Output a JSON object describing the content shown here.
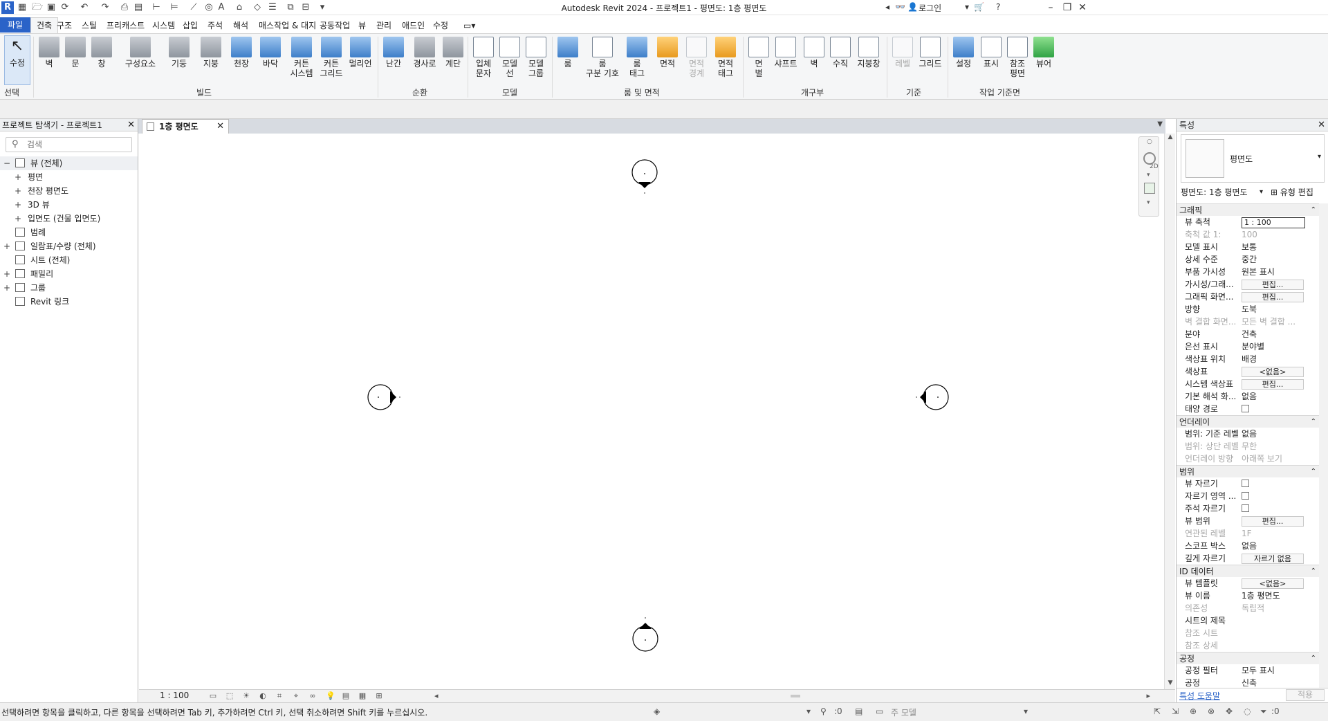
{
  "window": {
    "title": "Autodesk Revit 2024 - 프로젝트1 - 평면도: 1층 평면도",
    "logo_letter": "R",
    "login_label": "로그인",
    "help_label": "?"
  },
  "ribbon_tabs": [
    "파일",
    "건축",
    "구조",
    "스틸",
    "프리캐스트",
    "시스템",
    "삽입",
    "주석",
    "해석",
    "매스작업 & 대지",
    "공동작업",
    "뷰",
    "관리",
    "애드인",
    "수정"
  ],
  "ribbon": {
    "select_label": "선택",
    "panels": {
      "build": "빌드",
      "circulation": "순환",
      "model": "모델",
      "room_area": "룸 및 면적",
      "opening": "개구부",
      "datum": "기준",
      "work_plane": "작업 기준면"
    },
    "tools": {
      "modify": "수정",
      "wall": "벽",
      "door": "문",
      "window": "창",
      "component": "구성요소",
      "column": "기둥",
      "roof": "지붕",
      "ceiling": "천장",
      "floor": "바닥",
      "curtain_system": "커튼\n시스템",
      "curtain_grid": "커튼\n그리드",
      "mullion": "멀리언",
      "railing": "난간",
      "ramp": "경사로",
      "stair": "계단",
      "model_text": "입체\n문자",
      "model_line": "모델\n선",
      "model_group": "모델\n그룹",
      "room": "룸",
      "room_separator": "룸\n구분 기호",
      "room_tag": "룸\n태그",
      "area": "면적",
      "area_boundary": "면적\n경계",
      "area_tag": "면적\n태그",
      "by_face": "면\n별",
      "shaft": "샤프트",
      "wall_opening": "벽",
      "vertical": "수직",
      "dormer": "지붕창",
      "level": "레벨",
      "grid": "그리드",
      "set": "설정",
      "show": "표시",
      "ref_plane": "참조\n평면",
      "viewer": "뷰어"
    }
  },
  "project_browser": {
    "title": "프로젝트 탐색기 - 프로젝트1",
    "search_placeholder": "검색",
    "items": [
      {
        "toggle": "−",
        "label": "뷰 (전체)",
        "indent": 0,
        "selected": true,
        "icon": true
      },
      {
        "toggle": "+",
        "label": "평면",
        "indent": 1,
        "selected": false,
        "icon": false
      },
      {
        "toggle": "+",
        "label": "천장 평면도",
        "indent": 1,
        "selected": false,
        "icon": false
      },
      {
        "toggle": "+",
        "label": "3D 뷰",
        "indent": 1,
        "selected": false,
        "icon": false
      },
      {
        "toggle": "+",
        "label": "입면도 (건물 입면도)",
        "indent": 1,
        "selected": false,
        "icon": false
      },
      {
        "toggle": "",
        "label": "범례",
        "indent": 0,
        "selected": false,
        "icon": true
      },
      {
        "toggle": "+",
        "label": "일람표/수량 (전체)",
        "indent": 0,
        "selected": false,
        "icon": true
      },
      {
        "toggle": "",
        "label": "시트 (전체)",
        "indent": 0,
        "selected": false,
        "icon": true
      },
      {
        "toggle": "+",
        "label": "패밀리",
        "indent": 0,
        "selected": false,
        "icon": true
      },
      {
        "toggle": "+",
        "label": "그룹",
        "indent": 0,
        "selected": false,
        "icon": true
      },
      {
        "toggle": "",
        "label": "Revit 링크",
        "indent": 0,
        "selected": false,
        "icon": true
      }
    ]
  },
  "view_tab": {
    "label": "1층 평면도"
  },
  "view_control": {
    "scale": "1 : 100"
  },
  "properties": {
    "title": "특성",
    "type_name": "평면도",
    "selector": "평면도: 1층 평면도",
    "edit_type": "유형 편집",
    "groups": [
      {
        "name": "그래픽",
        "rows": [
          {
            "key": "뷰 축척",
            "val": "1 : 100",
            "kind": "input"
          },
          {
            "key": "축척 값    1:",
            "val": "100",
            "kind": "text",
            "dim": true
          },
          {
            "key": "모델 표시",
            "val": "보통",
            "kind": "text"
          },
          {
            "key": "상세 수준",
            "val": "중간",
            "kind": "text"
          },
          {
            "key": "부품 가시성",
            "val": "원본 표시",
            "kind": "text"
          },
          {
            "key": "가시성/그래...",
            "val": "편집...",
            "kind": "button"
          },
          {
            "key": "그래픽 화면...",
            "val": "편집...",
            "kind": "button"
          },
          {
            "key": "방향",
            "val": "도북",
            "kind": "text"
          },
          {
            "key": "벽 결합 화면...",
            "val": "모든 벽 결합 ...",
            "kind": "text",
            "dim": true
          },
          {
            "key": "분야",
            "val": "건축",
            "kind": "text"
          },
          {
            "key": "은선 표시",
            "val": "분야별",
            "kind": "text"
          },
          {
            "key": "색상표 위치",
            "val": "배경",
            "kind": "text"
          },
          {
            "key": "색상표",
            "val": "<없음>",
            "kind": "button"
          },
          {
            "key": "시스템 색상표",
            "val": "편집...",
            "kind": "button"
          },
          {
            "key": "기본 해석 화...",
            "val": "없음",
            "kind": "text"
          },
          {
            "key": "태양 경로",
            "val": "",
            "kind": "check"
          }
        ]
      },
      {
        "name": "언더레이",
        "rows": [
          {
            "key": "범위: 기준 레벨",
            "val": "없음",
            "kind": "text"
          },
          {
            "key": "범위: 상단 레벨",
            "val": "무한",
            "kind": "text",
            "dim": true
          },
          {
            "key": "언더레이 방향",
            "val": "아래쪽 보기",
            "kind": "text",
            "dim": true
          }
        ]
      },
      {
        "name": "범위",
        "rows": [
          {
            "key": "뷰 자르기",
            "val": "",
            "kind": "check"
          },
          {
            "key": "자르기 영역 ...",
            "val": "",
            "kind": "check"
          },
          {
            "key": "주석 자르기",
            "val": "",
            "kind": "check"
          },
          {
            "key": "뷰 범위",
            "val": "편집...",
            "kind": "button"
          },
          {
            "key": "연관된 레벨",
            "val": "1F",
            "kind": "text",
            "dim": true
          },
          {
            "key": "스코프 박스",
            "val": "없음",
            "kind": "text"
          },
          {
            "key": "깊게 자르기",
            "val": "자르기 없음",
            "kind": "button"
          }
        ]
      },
      {
        "name": "ID 데이터",
        "rows": [
          {
            "key": "뷰 템플릿",
            "val": "<없음>",
            "kind": "button"
          },
          {
            "key": "뷰 이름",
            "val": "1층 평면도",
            "kind": "text"
          },
          {
            "key": "의존성",
            "val": "독립적",
            "kind": "text",
            "dim": true
          },
          {
            "key": "시트의 제목",
            "val": "",
            "kind": "text"
          },
          {
            "key": "참조 시트",
            "val": "",
            "kind": "text",
            "dim": true
          },
          {
            "key": "참조 상세",
            "val": "",
            "kind": "text",
            "dim": true
          }
        ]
      },
      {
        "name": "공정",
        "rows": [
          {
            "key": "공정 필터",
            "val": "모두 표시",
            "kind": "text"
          },
          {
            "key": "공정",
            "val": "신축",
            "kind": "text"
          }
        ]
      }
    ],
    "help_link": "특성 도움말",
    "apply_label": "적용"
  },
  "status_bar": {
    "hint": "선택하려면 항목을 클릭하고, 다른 항목을 선택하려면 Tab 키, 추가하려면 Ctrl 키, 선택 취소하려면 Shift 키를 누르십시오.",
    "zero_a": ":0",
    "main_model": "주 모델",
    "zero_b": ":0"
  },
  "nav_bar": {
    "label_2d": "2D"
  },
  "colors": {
    "accent": "#2a63c8",
    "ribbon_bg": "#f5f6f7"
  }
}
